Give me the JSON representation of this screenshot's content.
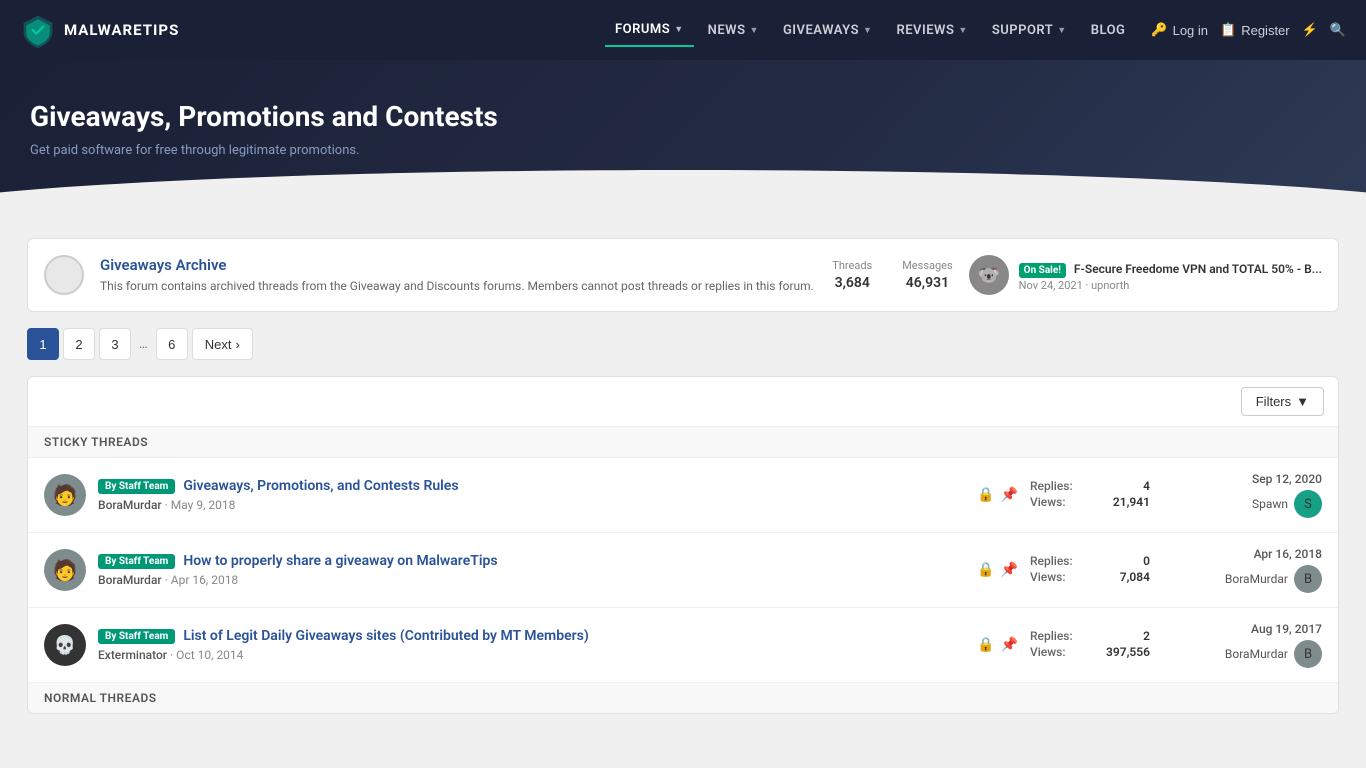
{
  "site": {
    "logo_text": "MALWARETIPS",
    "logo_icon": "🛡"
  },
  "nav": {
    "links": [
      {
        "label": "FORUMS",
        "active": true,
        "has_dropdown": true
      },
      {
        "label": "NEWS",
        "active": false,
        "has_dropdown": true
      },
      {
        "label": "GIVEAWAYS",
        "active": false,
        "has_dropdown": true
      },
      {
        "label": "REVIEWS",
        "active": false,
        "has_dropdown": true
      },
      {
        "label": "SUPPORT",
        "active": false,
        "has_dropdown": true
      },
      {
        "label": "BLOG",
        "active": false,
        "has_dropdown": false
      }
    ],
    "login_label": "Log in",
    "register_label": "Register"
  },
  "hero": {
    "title": "Giveaways, Promotions and Contests",
    "subtitle": "Get paid software for free through legitimate promotions."
  },
  "forum_archive": {
    "name": "Giveaways Archive",
    "description": "This forum contains archived threads from the Giveaway and Discounts forums. Members cannot post threads or replies in this forum.",
    "threads_label": "Threads",
    "threads_value": "3,684",
    "messages_label": "Messages",
    "messages_value": "46,931",
    "latest_badge": "On Sale!",
    "latest_title": "F-Secure Freedome VPN and TOTAL 50% - B...",
    "latest_date": "Nov 24, 2021",
    "latest_user": "upnorth",
    "latest_avatar": "🐨"
  },
  "pagination": {
    "pages": [
      "1",
      "2",
      "3",
      "6"
    ],
    "current": "1",
    "next_label": "Next",
    "ellipsis": "…"
  },
  "filters_label": "Filters",
  "sticky_section_label": "Sticky threads",
  "normal_section_label": "Normal threads",
  "threads": [
    {
      "id": 1,
      "sticky": true,
      "badge": "By Staff Team",
      "title": "Giveaways, Promotions, and Contests Rules",
      "author": "BoraMurdar",
      "date": "May 9, 2018",
      "replies_label": "Replies:",
      "replies": "4",
      "views_label": "Views:",
      "views": "21,941",
      "last_date": "Sep 12, 2020",
      "last_user": "Spawn",
      "last_user_initial": "S",
      "last_avatar_color": "av-teal",
      "author_avatar": "🧑",
      "author_avatar_color": "av-gray"
    },
    {
      "id": 2,
      "sticky": true,
      "badge": "By Staff Team",
      "title": "How to properly share a giveaway on MalwareTips",
      "author": "BoraMurdar",
      "date": "Apr 16, 2018",
      "replies_label": "Replies:",
      "replies": "0",
      "views_label": "Views:",
      "views": "7,084",
      "last_date": "Apr 16, 2018",
      "last_user": "BoraMurdar",
      "last_user_initial": "B",
      "last_avatar_color": "av-gray",
      "author_avatar": "🧑",
      "author_avatar_color": "av-gray"
    },
    {
      "id": 3,
      "sticky": true,
      "badge": "By Staff Team",
      "title": "List of Legit Daily Giveaways sites (Contributed by MT Members)",
      "author": "Exterminator",
      "date": "Oct 10, 2014",
      "replies_label": "Replies:",
      "replies": "2",
      "views_label": "Views:",
      "views": "397,556",
      "last_date": "Aug 19, 2017",
      "last_user": "BoraMurdar",
      "last_user_initial": "B",
      "last_avatar_color": "av-gray",
      "author_avatar": "💀",
      "author_avatar_color": "av-dark"
    }
  ]
}
